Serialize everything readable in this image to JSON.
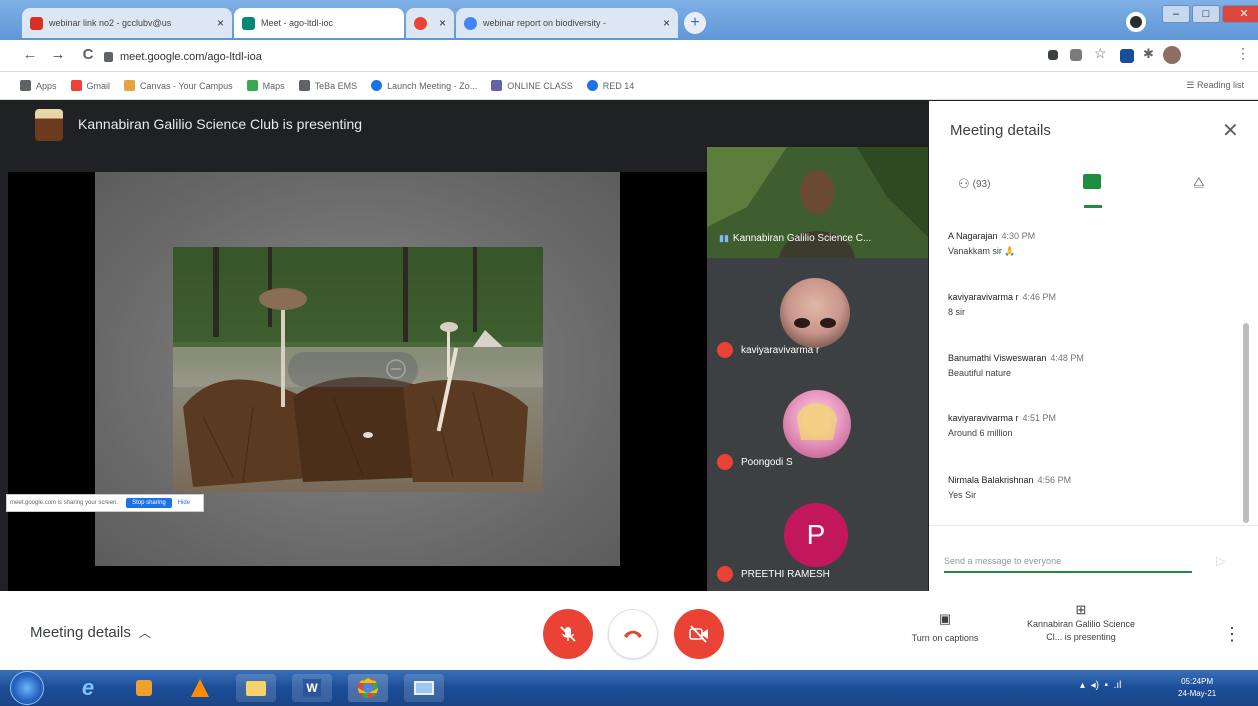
{
  "browser": {
    "tabs": [
      {
        "title": "webinar link no2 - gcclubv@us",
        "fav_color": "#d93025",
        "active": false
      },
      {
        "title": "Meet - ago-ltdl-ioc",
        "fav_color": "#00897b",
        "active": true
      },
      {
        "title": "",
        "fav_color": "#ea4335",
        "active": false
      },
      {
        "title": "webinar report on biodiversity - ",
        "fav_color": "#4285f4",
        "active": false
      }
    ],
    "new_tab_label": "+",
    "window_controls": {
      "minimize": "–",
      "maximize": "□",
      "close": "✕"
    },
    "nav": {
      "back": "←",
      "forward": "→",
      "reload": "C"
    },
    "url": "meet.google.com/ago-ltdl-ioa",
    "bookmarks": [
      {
        "label": "Apps",
        "color": "#5f6368"
      },
      {
        "label": "Gmail",
        "color": "#ea4335"
      },
      {
        "label": "Canvas - Your Campus",
        "color": "#e8a33d"
      },
      {
        "label": "Maps",
        "color": "#34a853"
      },
      {
        "label": "TeBa EMS",
        "color": "#5f6368"
      },
      {
        "label": "Launch Meeting - Zo...",
        "color": "#1a73e8"
      },
      {
        "label": "ONLINE CLASS",
        "color": "#6264a7"
      },
      {
        "label": "RED 14",
        "color": "#1a73e8"
      }
    ],
    "reading_list": "Reading list"
  },
  "stage": {
    "presenter_banner": "Kannabiran Galilio Science Club is presenting",
    "share_banner": {
      "text": "meet.google.com is sharing your screen.",
      "stop": "Stop sharing",
      "hide": "Hide"
    }
  },
  "participants": [
    {
      "name": "Kannabiran Galilio Science C..."
    },
    {
      "name": "kaviyaravivarma r"
    },
    {
      "name": "Poongodi S"
    },
    {
      "name": "PREETHI RAMESH",
      "initial": "P"
    }
  ],
  "panel": {
    "title": "Meeting details",
    "close": "✕",
    "people_count": "(93)",
    "messages": [
      {
        "sender": "A Nagarajan",
        "time": "4:30 PM",
        "text": "Vanakkam sir 🙏"
      },
      {
        "sender": "kaviyaravivarma r",
        "time": "4:46 PM",
        "text": "8 sir"
      },
      {
        "sender": "Banumathi Visweswaran",
        "time": "4:48 PM",
        "text": "Beautiful nature"
      },
      {
        "sender": "kaviyaravivarma r",
        "time": "4:51 PM",
        "text": "Around 6 million"
      },
      {
        "sender": "Nirmala Balakrishnan",
        "time": "4:56 PM",
        "text": "Yes Sir"
      }
    ],
    "input_placeholder": "Send a message to everyone",
    "send": "▷"
  },
  "controls": {
    "meeting_details": "Meeting details",
    "captions_label": "Turn on captions",
    "presenting_label": "Kannabiran Galilio Science Cl... is presenting",
    "more": "⋮"
  },
  "taskbar": {
    "time": "05:24PM",
    "date": "24-May-21"
  },
  "colors": {
    "meet_green": "#1e8e3e",
    "danger_red": "#ea4335",
    "avatar_pink": "#c2185b"
  }
}
